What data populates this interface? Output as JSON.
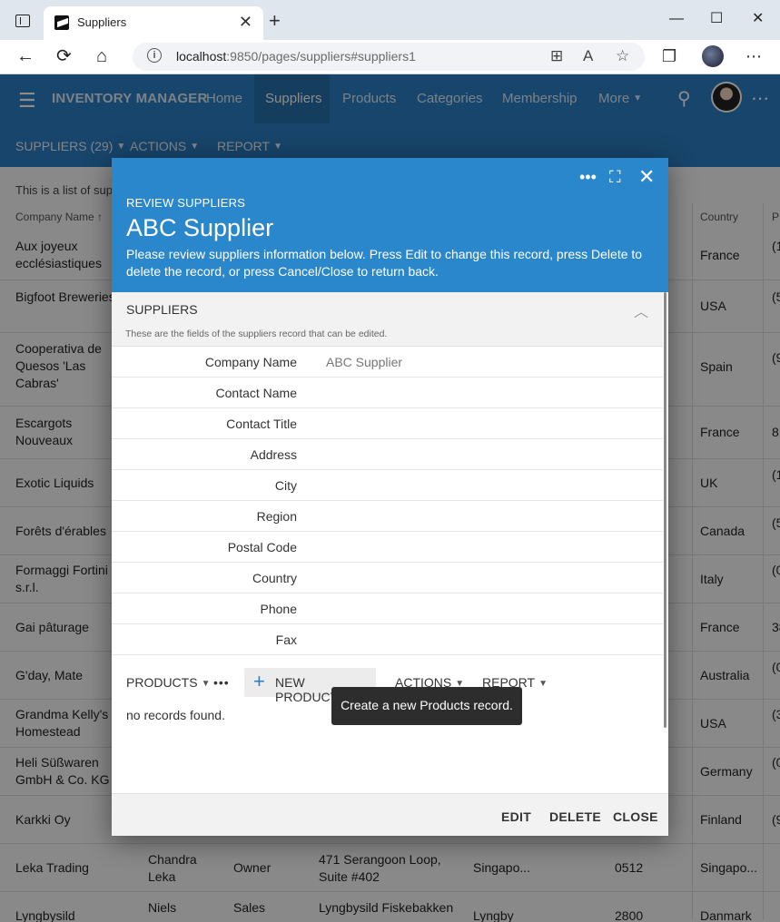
{
  "browser": {
    "tab_title": "Suppliers",
    "tab_close": "✕",
    "new_tab": "+",
    "url_host": "localhost",
    "url_rest": ":9850/pages/suppliers#suppliers1",
    "minimize": "—",
    "maximize": "☐",
    "close": "✕"
  },
  "appbar": {
    "brand": "INVENTORY MANAGER",
    "nav": [
      "Home",
      "Suppliers",
      "Products",
      "Categories",
      "Membership",
      "More"
    ],
    "sub": [
      "SUPPLIERS (29)",
      "ACTIONS",
      "REPORT"
    ]
  },
  "grid": {
    "intro": "This is a list of sup",
    "headers": [
      "Company Name ↑",
      "Country",
      "P"
    ],
    "rows": [
      {
        "name": "Aux joyeux ecclésiastiques",
        "country": "France",
        "phone": "(1"
      },
      {
        "name": "Bigfoot Breweries",
        "country": "USA",
        "phone": "(5"
      },
      {
        "name": "Cooperativa de Quesos 'Las Cabras'",
        "country": "Spain",
        "phone": "(9"
      },
      {
        "name": "Escargots Nouveaux",
        "country": "France",
        "phone": "8"
      },
      {
        "name": "Exotic Liquids",
        "country": "UK",
        "phone": "(1"
      },
      {
        "name": "Forêts d'érables",
        "country": "Canada",
        "phone": "(5"
      },
      {
        "name": "Formaggi Fortini s.r.l.",
        "country": "Italy",
        "phone": "(0"
      },
      {
        "name": "Gai pâturage",
        "country": "France",
        "phone": "38"
      },
      {
        "name": "G'day, Mate",
        "country": "Australia",
        "phone": "(0"
      },
      {
        "name": "Grandma Kelly's Homestead",
        "country": "USA",
        "phone": "(3"
      },
      {
        "name": "Heli Süßwaren GmbH & Co. KG",
        "country": "Germany",
        "phone": "(0"
      },
      {
        "name": "Karkki Oy",
        "country": "Finland",
        "phone": "(9"
      },
      {
        "name": "Leka Trading",
        "contact": "Chandra Leka",
        "title": "Owner",
        "address": "471 Serangoon Loop, Suite #402",
        "city": "Singapo...",
        "postal": "0512",
        "country": "Singapo...",
        "phone": ""
      },
      {
        "name": "Lyngbysild",
        "contact": "Niels",
        "title": "Sales",
        "address": "Lyngbysild Fiskebakken",
        "city": "Lyngby",
        "postal": "2800",
        "country": "Danmark",
        "phone": ""
      }
    ]
  },
  "modal": {
    "kicker": "REVIEW SUPPLIERS",
    "title": "ABC Supplier",
    "description": "Please review suppliers information below. Press Edit to change this record, press Delete to delete the record, or press Cancel/Close to return back.",
    "section_name": "SUPPLIERS",
    "section_hint": "These are the fields of the suppliers record that can be edited.",
    "fields": [
      {
        "label": "Company Name",
        "value": "ABC Supplier"
      },
      {
        "label": "Contact Name",
        "value": ""
      },
      {
        "label": "Contact Title",
        "value": ""
      },
      {
        "label": "Address",
        "value": ""
      },
      {
        "label": "City",
        "value": ""
      },
      {
        "label": "Region",
        "value": ""
      },
      {
        "label": "Postal Code",
        "value": ""
      },
      {
        "label": "Country",
        "value": ""
      },
      {
        "label": "Phone",
        "value": ""
      },
      {
        "label": "Fax",
        "value": ""
      }
    ],
    "products_label": "PRODUCTS",
    "new_products": "NEW PRODUCTS",
    "actions": "ACTIONS",
    "report": "REPORT",
    "no_records": "no records found.",
    "tooltip": "Create a new Products record.",
    "buttons": {
      "edit": "EDIT",
      "delete": "DELETE",
      "close": "CLOSE"
    }
  },
  "colors": {
    "appbar": "#2b7fc4",
    "modal_header": "#2b87cc",
    "tooltip": "#2d2d2d"
  }
}
